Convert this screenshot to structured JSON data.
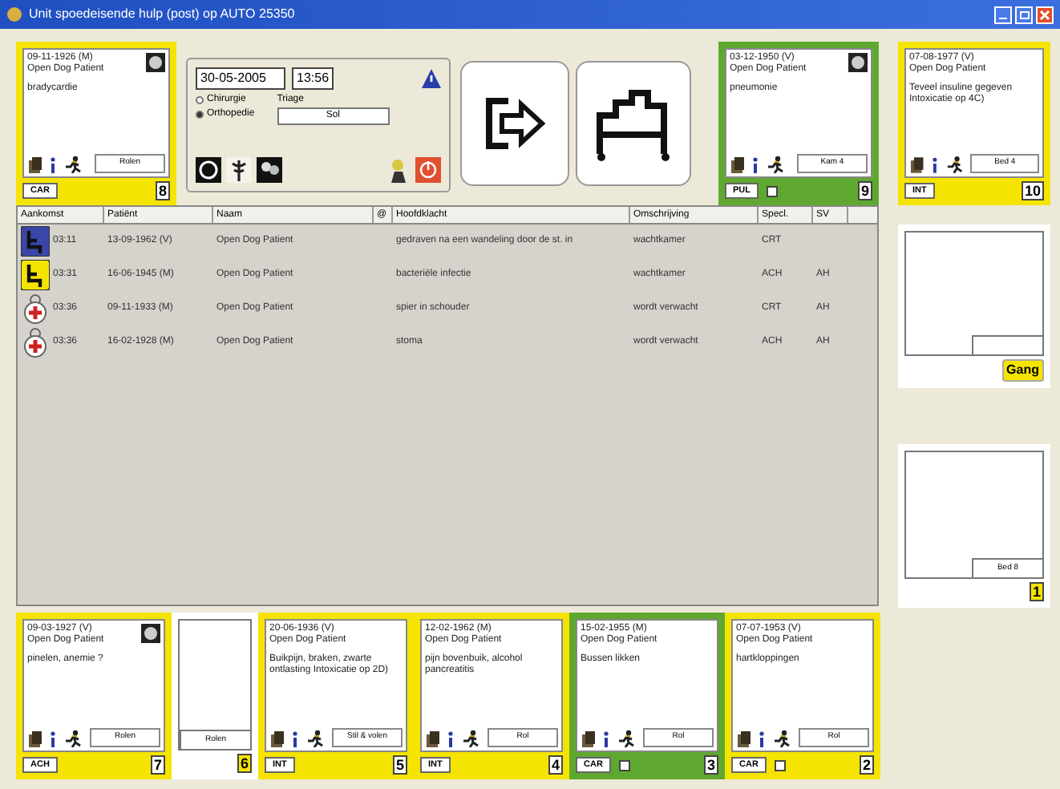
{
  "window": {
    "title": "Unit spoedeisende hulp (post) op AUTO 25350"
  },
  "top_cards": [
    {
      "kind": "bed",
      "color": "#f5e400",
      "date": "09-11-1926 (M)",
      "name": "Open Dog Patient",
      "complaint": "bradycardie",
      "button": "Rolen",
      "code": "CAR",
      "number": "8",
      "avatar": true
    },
    {
      "kind": "bed",
      "color": "#5fa830",
      "date": "03-12-1950 (V)",
      "name": "Open Dog Patient",
      "complaint": "pneumonie",
      "button": "Kam 4",
      "code": "PUL",
      "number": "9",
      "avatar": true,
      "checkbox": {
        "checked": false
      }
    }
  ],
  "control_panel": {
    "date": "30-05-2005",
    "time": "13:56",
    "options": [
      {
        "label": "Chirurgie",
        "selected": false
      },
      {
        "label": "Orthopedie",
        "selected": true
      }
    ],
    "triage": {
      "label": "Triage",
      "value": "Sol"
    }
  },
  "table": {
    "columns": [
      "Aankomst",
      "Patiënt",
      "Naam",
      "@",
      "Hoofdklacht",
      "Omschrijving",
      "Specl.",
      "SV"
    ],
    "rows": [
      {
        "kind": "chair",
        "color": "#3a46a8",
        "cells": [
          "03:11",
          "13-09-1962 (V)",
          "Open Dog Patient",
          "",
          "gedraven na een wandeling door de st. in",
          "wachtkamer",
          "CRT",
          ""
        ]
      },
      {
        "kind": "chair",
        "color": "#f5e400",
        "cells": [
          "03:31",
          "16-06-1945 (M)",
          "Open Dog Patient",
          "",
          "bacteriële infectie",
          "wachtkamer",
          "ACH",
          "AH"
        ]
      },
      {
        "kind": "stretcher",
        "cells": [
          "03:36",
          "09-11-1933 (M)",
          "Open Dog Patient",
          "",
          "spier in schouder",
          "wordt verwacht",
          "CRT",
          "AH"
        ]
      },
      {
        "kind": "stretcher",
        "cells": [
          "03:36",
          "16-02-1928 (M)",
          "Open Dog Patient",
          "",
          "stoma",
          "wordt verwacht",
          "ACH",
          "AH"
        ]
      }
    ]
  },
  "side": [
    {
      "kind": "bed",
      "color": "#f5e400",
      "date": "07-08-1977 (V)",
      "name": "Open Dog Patient",
      "complaint": "Teveel insuline gegeven Intoxicatie op 4C)",
      "button": "Bed 4",
      "code": "INT",
      "number": "10",
      "avatar": false
    },
    {
      "kind": "gang",
      "label": "Gang"
    },
    {
      "kind": "empty",
      "button": "Bed 8",
      "number": "1"
    }
  ],
  "bottom_cards": [
    {
      "kind": "bed",
      "color": "#f5e400",
      "date": "09-03-1927 (V)",
      "name": "Open Dog Patient",
      "complaint": "pinelen, anemie ?",
      "button": "Rolen",
      "code": "ACH",
      "number": "7",
      "avatar": true
    },
    {
      "kind": "empty",
      "button": "Rolen",
      "number": "6"
    },
    {
      "kind": "bed",
      "color": "#f5e400",
      "date": "20-06-1936 (V)",
      "name": "Open Dog Patient",
      "complaint": "Buikpijn, braken, zwarte ontlasting Intoxicatie op 2D)",
      "button": "Stil & volen",
      "code": "INT",
      "number": "5",
      "avatar": false
    },
    {
      "kind": "bed",
      "color": "#f5e400",
      "date": "12-02-1962 (M)",
      "name": "Open Dog Patient",
      "complaint": "pijn bovenbuik, alcohol pancreatitis",
      "button": "Rol",
      "code": "INT",
      "number": "4",
      "avatar": false
    },
    {
      "kind": "bed",
      "color": "#5fa830",
      "date": "15-02-1955 (M)",
      "name": "Open Dog Patient",
      "complaint": "Bussen likken",
      "button": "Rol",
      "code": "CAR",
      "number": "3",
      "avatar": false,
      "checkbox": {
        "checked": false
      }
    },
    {
      "kind": "bed",
      "color": "#f5e400",
      "date": "07-07-1953 (V)",
      "name": "Open Dog Patient",
      "complaint": "hartkloppingen",
      "button": "Rol",
      "code": "CAR",
      "number": "2",
      "avatar": false,
      "checkbox": {
        "checked": false
      }
    }
  ]
}
